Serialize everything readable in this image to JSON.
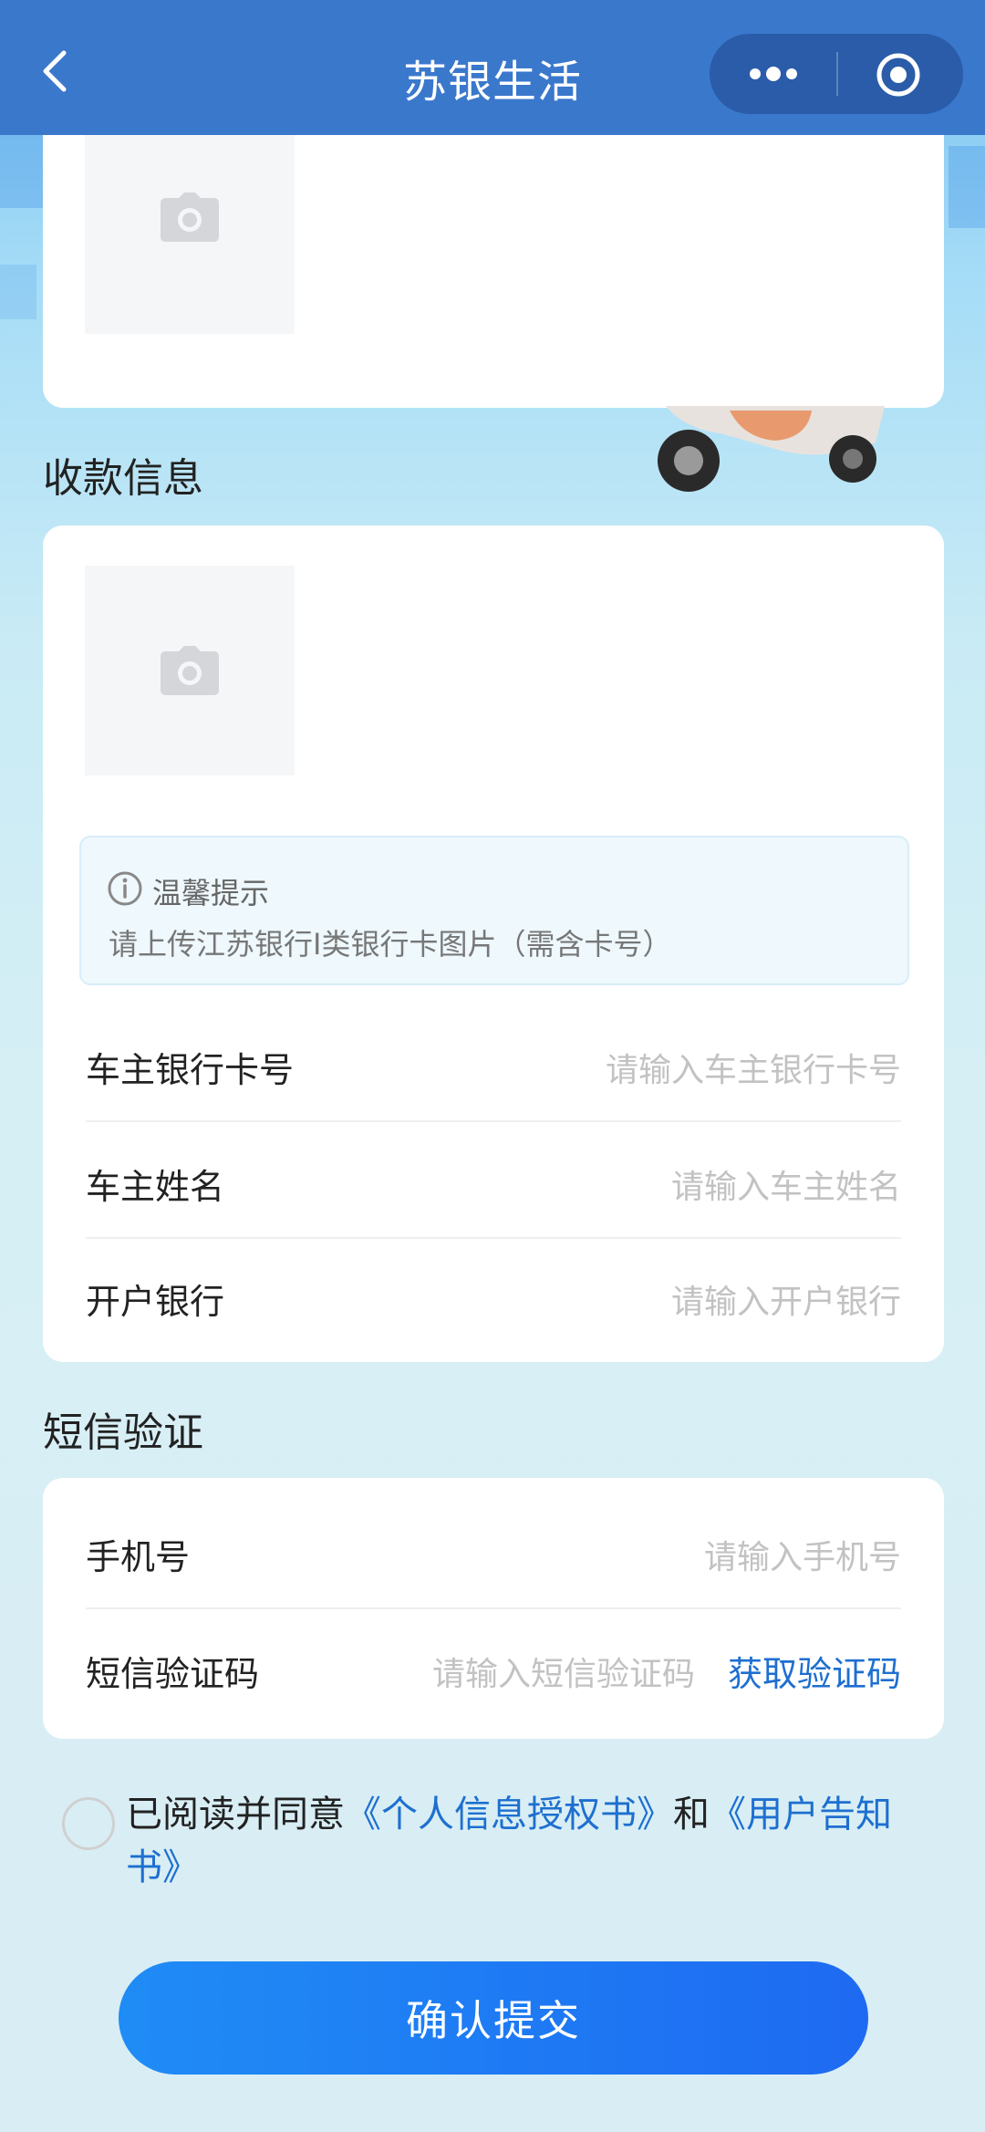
{
  "header": {
    "title": "苏银生活"
  },
  "payment_section": {
    "title": "收款信息"
  },
  "tip": {
    "title": "温馨提示",
    "text": "请上传江苏银行I类银行卡图片（需含卡号）"
  },
  "payment_fields": [
    {
      "label": "车主银行卡号",
      "placeholder": "请输入车主银行卡号"
    },
    {
      "label": "车主姓名",
      "placeholder": "请输入车主姓名"
    },
    {
      "label": "开户银行",
      "placeholder": "请输入开户银行"
    }
  ],
  "sms_section": {
    "title": "短信验证"
  },
  "sms_fields": [
    {
      "label": "手机号",
      "placeholder": "请输入手机号"
    },
    {
      "label": "短信验证码",
      "placeholder": "请输入短信验证码",
      "action": "获取验证码"
    }
  ],
  "agreement": {
    "prefix": "已阅读并同意",
    "link1": "《个人信息授权书》",
    "middle": "和",
    "link2": "《用户告知书》",
    "checked": false
  },
  "submit_label": "确认提交",
  "colors": {
    "header": "#3a78cc",
    "link": "#1e6fd0",
    "button": "#1e7cf3"
  }
}
